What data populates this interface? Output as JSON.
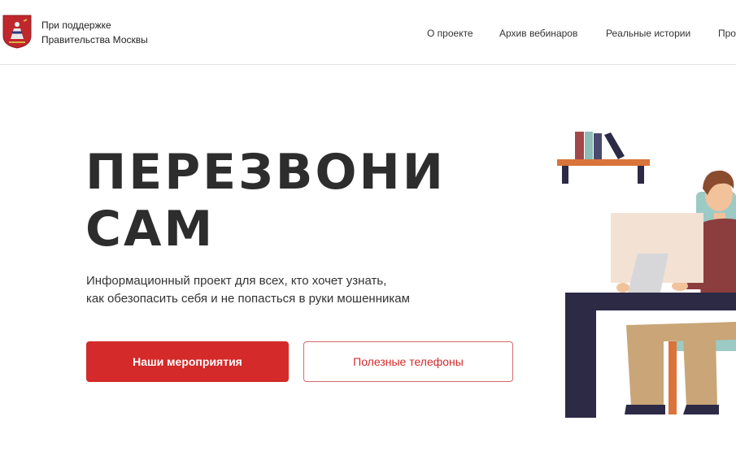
{
  "header": {
    "support_line1": "При поддержке",
    "support_line2": "Правительства Москвы",
    "nav": [
      "О проекте",
      "Архив вебинаров",
      "Реальные истории",
      "Про"
    ]
  },
  "hero": {
    "title_line1": "ПЕРЕЗВОНИ",
    "title_line2": "САМ",
    "subtitle_line1": "Информационный проект для всех, кто хочет узнать,",
    "subtitle_line2": "как обезопасить себя и не попасться в руки мошенникам",
    "primary_button": "Наши мероприятия",
    "secondary_button": "Полезные телефоны"
  },
  "colors": {
    "accent": "#d42a2a",
    "title": "#2d2d2d",
    "desk": "#2c2a45"
  },
  "icons": {
    "logo": "moscow-coat-of-arms-icon",
    "illustration": "man-at-computer-illustration"
  }
}
